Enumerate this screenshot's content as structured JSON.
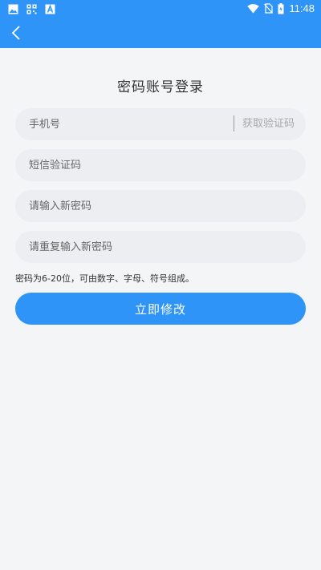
{
  "status_bar": {
    "time": "11:48",
    "left_icons": [
      "image-icon",
      "qr-icon",
      "font-icon"
    ],
    "right_icons": [
      "wifi-icon",
      "no-sim-icon",
      "battery-icon"
    ]
  },
  "header": {
    "back_icon": "chevron-left-icon"
  },
  "form": {
    "title": "密码账号登录",
    "phone_placeholder": "手机号",
    "get_code_label": "获取验证码",
    "sms_code_placeholder": "短信验证码",
    "new_password_placeholder": "请输入新密码",
    "confirm_password_placeholder": "请重复输入新密码",
    "hint": "密码为6-20位，可由数字、字母、符号组成。",
    "submit_label": "立即修改"
  },
  "colors": {
    "primary": "#2e94f8",
    "background": "#f4f5f7",
    "field": "#eceef1",
    "text": "#333333",
    "muted": "#a8a8a8"
  }
}
